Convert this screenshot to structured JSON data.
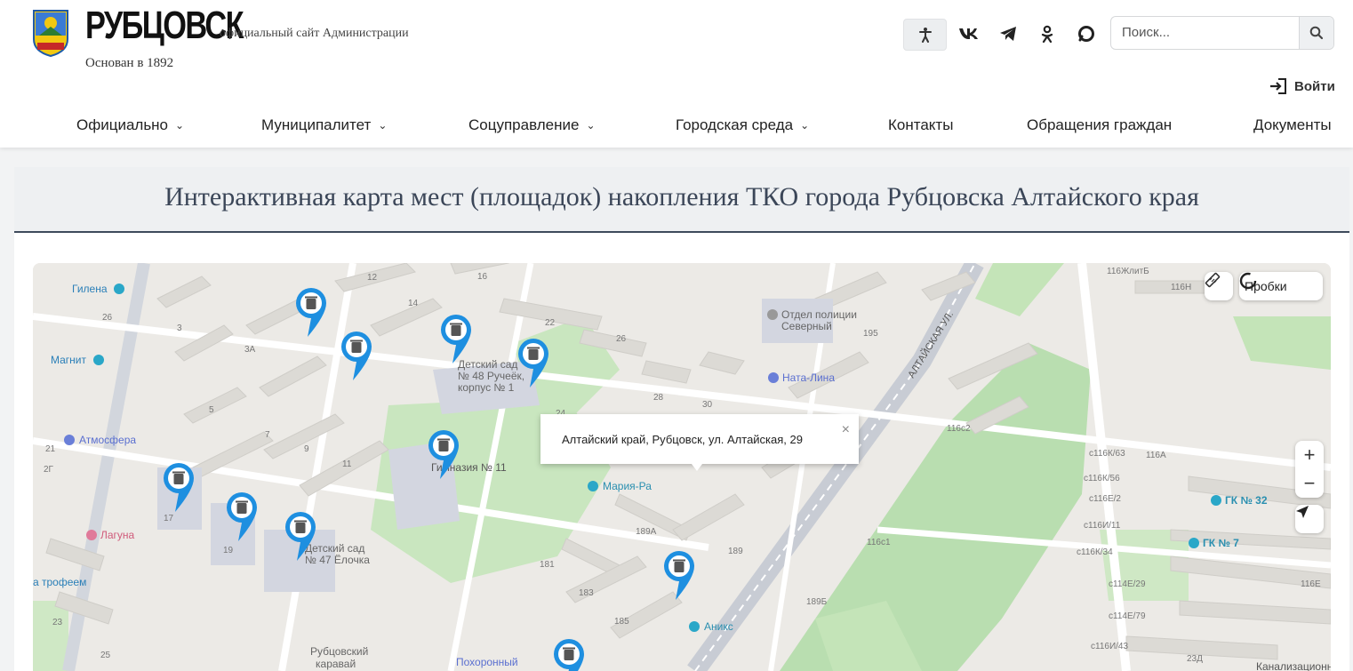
{
  "header": {
    "logo_alt": "Герб Рубцовска",
    "site_name": "РУБЦОВСК",
    "site_subtitle": "официальный сайт Администрации",
    "founded": "Основан в 1892",
    "search_placeholder": "Поиск...",
    "login_label": "Войти",
    "social_icons": [
      "accessibility-icon",
      "vk-icon",
      "telegram-icon",
      "odnoklassniki-icon",
      "max-icon"
    ]
  },
  "nav": {
    "items": [
      {
        "label": "Официально",
        "dropdown": true
      },
      {
        "label": "Муниципалитет",
        "dropdown": true
      },
      {
        "label": "Соцуправление",
        "dropdown": true
      },
      {
        "label": "Городская среда",
        "dropdown": true
      },
      {
        "label": "Контакты",
        "dropdown": false
      },
      {
        "label": "Обращения граждан",
        "dropdown": false
      },
      {
        "label": "Документы",
        "dropdown": false
      }
    ]
  },
  "page": {
    "title": "Интерактивная карта мест (площадок) накопления ТКО города Рубцовска Алтайского края"
  },
  "map": {
    "traffic_label": "Пробки",
    "zoom_in": "+",
    "zoom_out": "−",
    "popup_text": "Алтайский край, Рубцовск, ул. Алтайская, 29",
    "popup_close": "×",
    "street_label": "АЛТАЙСКАЯ УЛ.",
    "pois": {
      "gilena": "Гилена",
      "magnit": "Магнит",
      "atmosfera": "Атмосфера",
      "laguna": "Лагуна",
      "trofeem": "а трофеем",
      "kindergarten48": [
        "Детский сад",
        "№ 48 Ручеёк,",
        "корпус № 1"
      ],
      "gymnasium": "Гимназия № 11",
      "kindergarten47": [
        "Детский сад",
        "№ 47 Ёлочка"
      ],
      "police": [
        "Отдел полиции",
        "Северный"
      ],
      "natalina": "Ната-Лина",
      "mariya": "Мария-Ра",
      "aniks": "Аникс",
      "karavai": [
        "Рубцовский",
        "каравай"
      ],
      "pokhoronny": "Похоронный",
      "gk32": "ГК № 32",
      "gk7": "ГК № 7",
      "kanal": "Канализационно-"
    },
    "house_numbers": [
      "12",
      "14",
      "16",
      "22",
      "26",
      "28",
      "30",
      "3",
      "3А",
      "5",
      "7",
      "9",
      "11",
      "17",
      "19",
      "21",
      "23",
      "25",
      "24",
      "26",
      "2Г",
      "116ЖлитБ",
      "116Н",
      "195",
      "116с2",
      "116А",
      "116с1",
      "189А",
      "189",
      "181",
      "183",
      "185",
      "189Б",
      "с116К/63",
      "с116К/56",
      "с116Е/2",
      "с116И/11",
      "с116К/34",
      "с114Е/29",
      "с114Е/79",
      "с116И/43",
      "116Е",
      "23Д"
    ]
  }
}
